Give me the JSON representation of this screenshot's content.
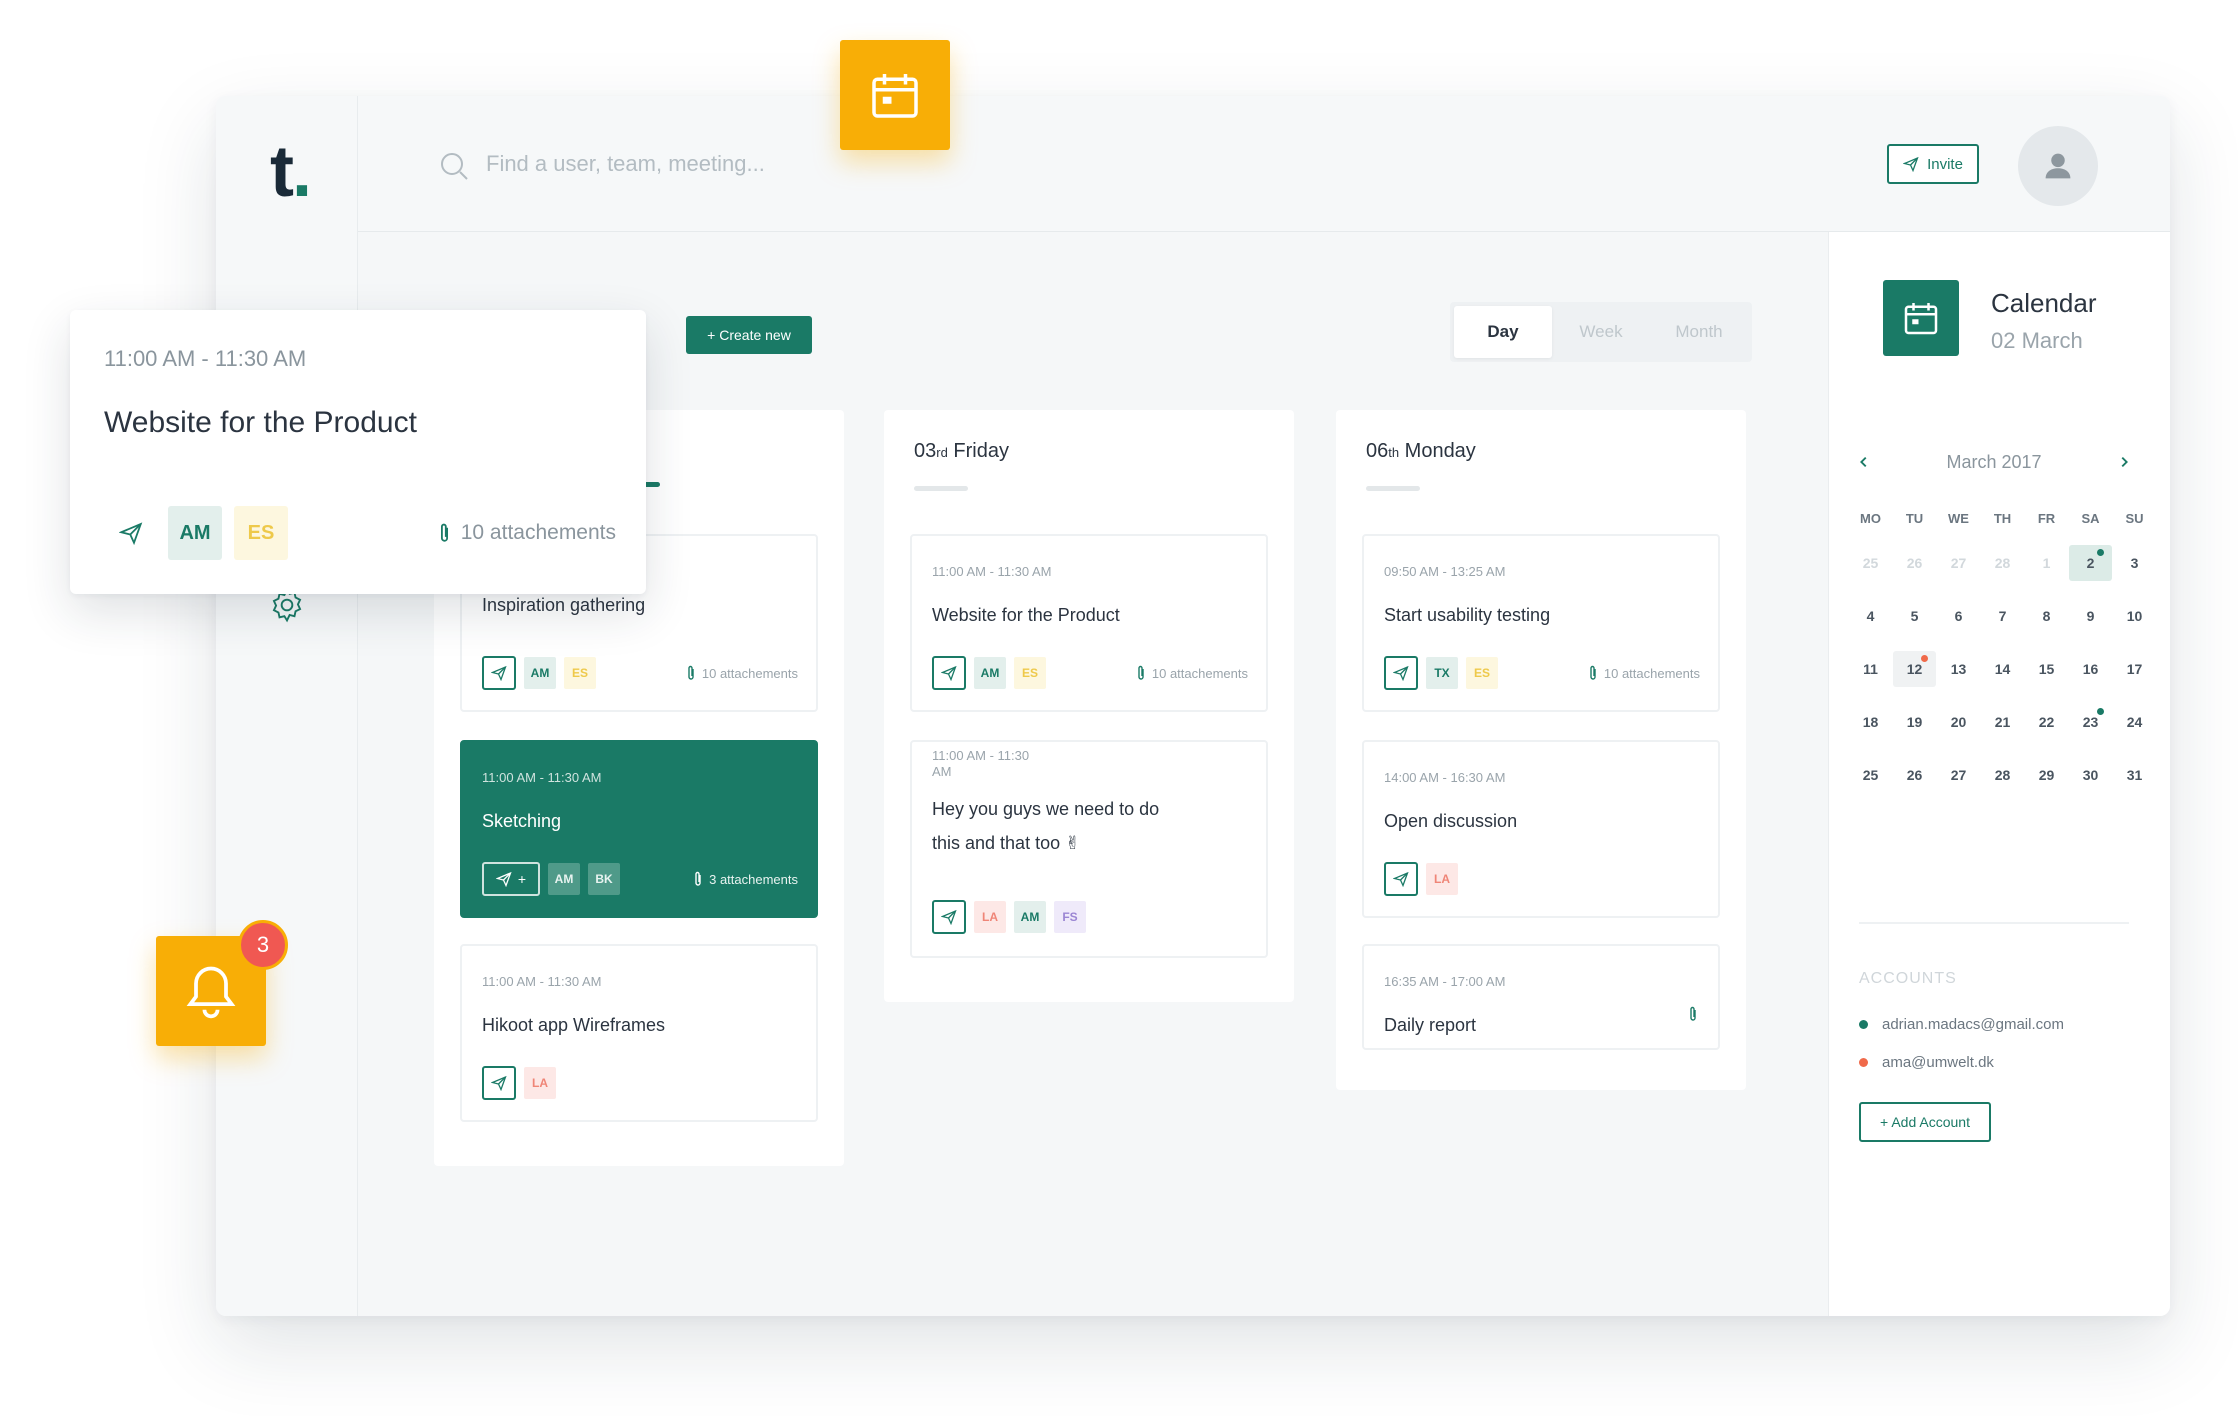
{
  "app": {
    "logo": "t",
    "logo_dot": "."
  },
  "search": {
    "placeholder": "Find a user, team, meeting..."
  },
  "header": {
    "invite_label": "Invite"
  },
  "toolbar": {
    "create_label": "+ Create new",
    "views": [
      "Day",
      "Week",
      "Month"
    ],
    "active_view": "Day"
  },
  "columns": [
    {
      "title_num": "",
      "title_sup": "",
      "title_day": "",
      "cards": [
        {
          "time": "",
          "title": "Inspiration gathering",
          "tags": [
            "AM",
            "ES"
          ],
          "attachments": "10 attachements"
        },
        {
          "time": "11:00 AM - 11:30 AM",
          "title": "Sketching",
          "tags": [
            "AM",
            "BK"
          ],
          "attachments": "3 attachements",
          "highlight": true
        },
        {
          "time": "11:00 AM - 11:30 AM",
          "title": "Hikoot app Wireframes",
          "tags": [
            "LA"
          ],
          "attachments": ""
        }
      ]
    },
    {
      "title_num": "03",
      "title_sup": "rd",
      "title_day": "Friday",
      "cards": [
        {
          "time": "11:00 AM - 11:30 AM",
          "title": "Website for the Product",
          "tags": [
            "AM",
            "ES"
          ],
          "attachments": "10 attachements"
        },
        {
          "time": "11:00 AM - 11:30 AM",
          "title": "Hey you guys we need to do this and that too ✌",
          "tags": [
            "LA",
            "AM",
            "FS"
          ],
          "attachments": ""
        }
      ]
    },
    {
      "title_num": "06",
      "title_sup": "th",
      "title_day": "Monday",
      "cards": [
        {
          "time": "09:50 AM - 13:25 AM",
          "title": "Start usability testing",
          "tags": [
            "TX",
            "ES"
          ],
          "attachments": "10 attachements"
        },
        {
          "time": "14:00 AM - 16:30 AM",
          "title": "Open discussion",
          "tags": [
            "LA"
          ],
          "attachments": ""
        },
        {
          "time": "16:35 AM - 17:00 AM",
          "title": "Daily report",
          "tags": [],
          "attachments": ""
        }
      ]
    }
  ],
  "calendar": {
    "title": "Calendar",
    "date": "02 March",
    "month_label": "March 2017",
    "weekdays": [
      "MO",
      "TU",
      "WE",
      "TH",
      "FR",
      "SA",
      "SU"
    ],
    "weeks": [
      [
        "25",
        "26",
        "27",
        "28",
        "1",
        "2",
        "3"
      ],
      [
        "4",
        "5",
        "6",
        "7",
        "8",
        "9",
        "10"
      ],
      [
        "11",
        "12",
        "13",
        "14",
        "15",
        "16",
        "17"
      ],
      [
        "18",
        "19",
        "20",
        "21",
        "22",
        "23",
        "24"
      ],
      [
        "25",
        "26",
        "27",
        "28",
        "29",
        "30",
        "31"
      ]
    ],
    "accounts_heading": "ACCOUNTS",
    "accounts": [
      {
        "email": "adrian.madacs@gmail.com",
        "color": "#1a7a66"
      },
      {
        "email": "ama@umwelt.dk",
        "color": "#f06a4a"
      }
    ],
    "add_account_label": "+ Add Account"
  },
  "popup": {
    "time": "11:00 AM - 11:30 AM",
    "title": "Website for the Product",
    "tags": [
      "AM",
      "ES"
    ],
    "attachments": "10 attachements"
  },
  "notifications": {
    "count": "3"
  },
  "colors": {
    "brand": "#1a7a66",
    "accent": "#f8ae06",
    "alert": "#f05852"
  },
  "icons": [
    "search-icon",
    "send-icon",
    "paperclip-icon",
    "calendar-icon",
    "bell-icon",
    "document-icon",
    "chat-icon",
    "gear-icon",
    "user-icon",
    "chevron-left-icon",
    "chevron-right-icon"
  ]
}
